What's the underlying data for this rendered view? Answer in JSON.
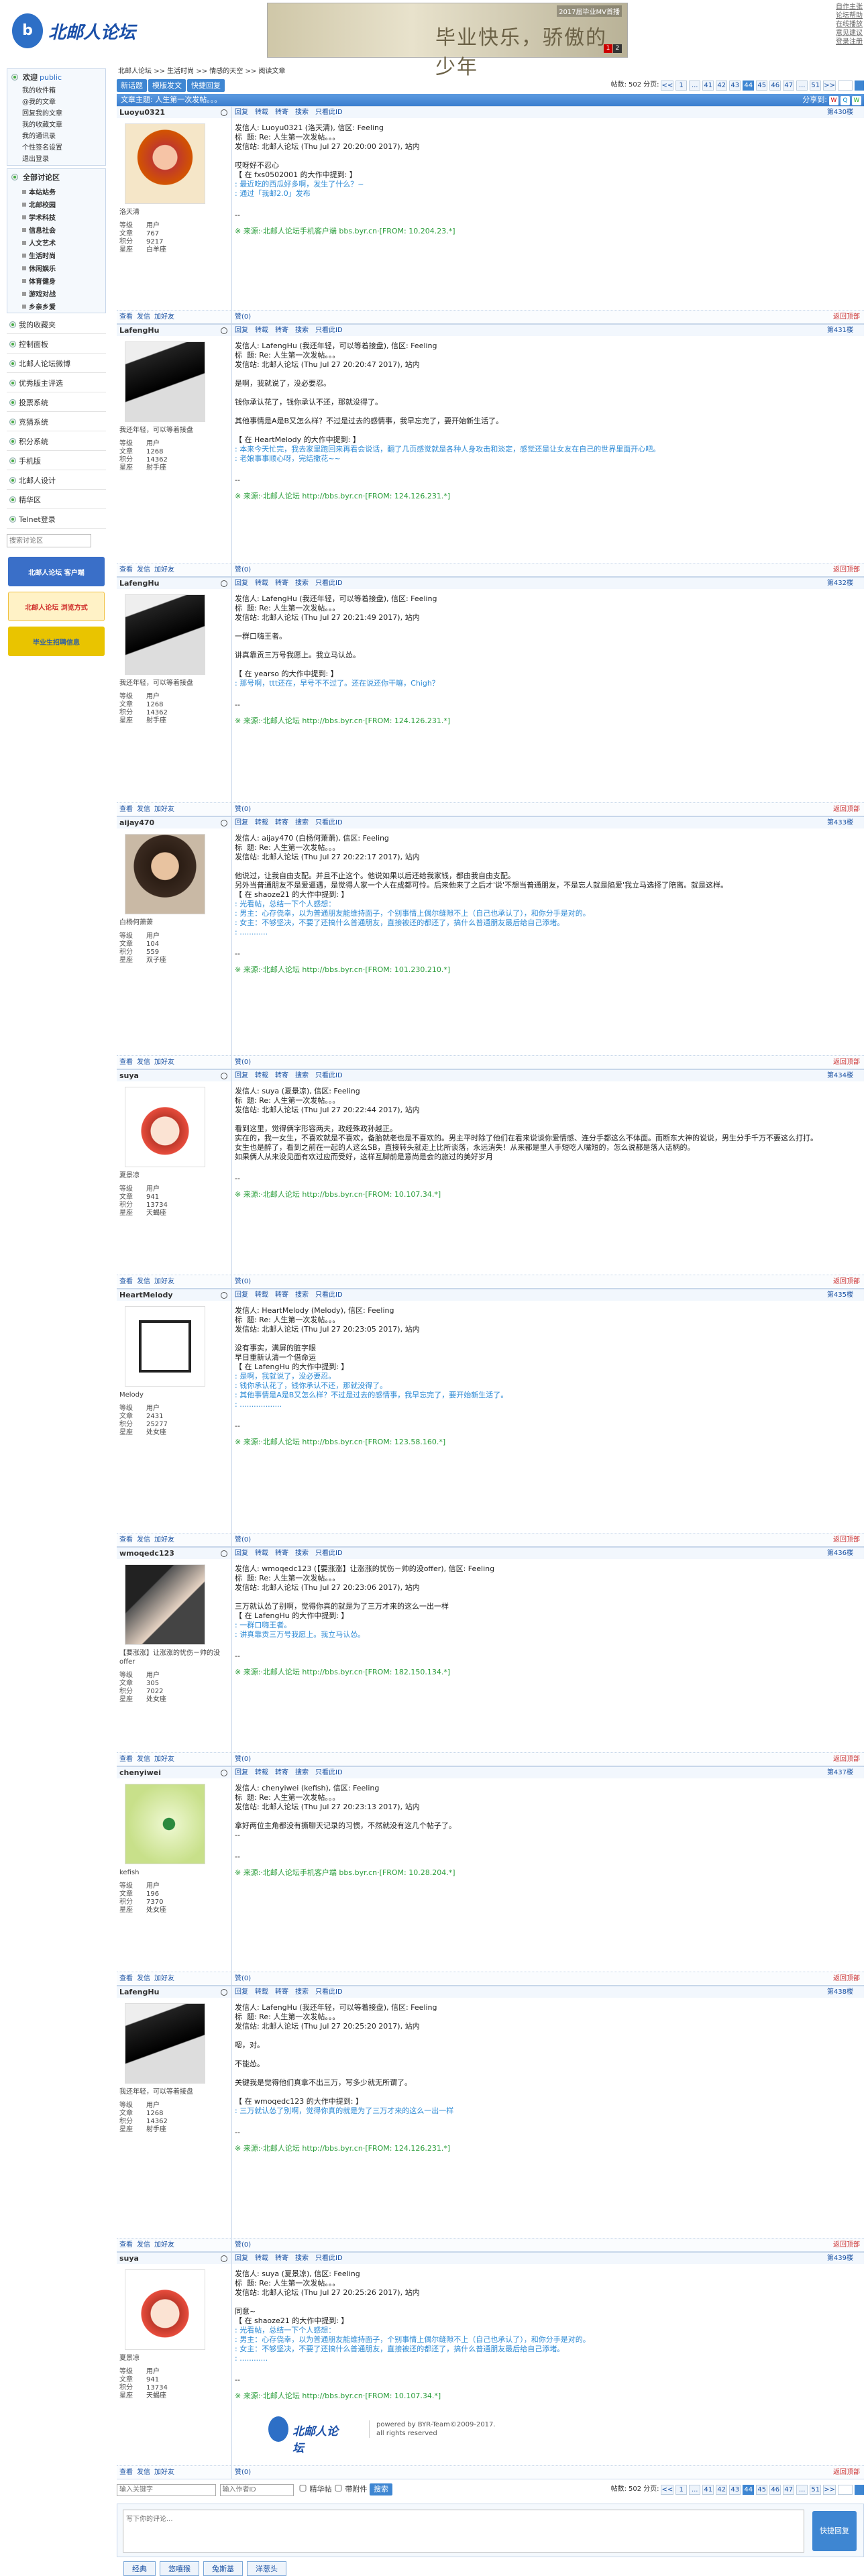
{
  "site": {
    "logo": "北邮人论坛",
    "top_links": [
      "自作主张",
      "论坛帮助",
      "在线播放",
      "意见建议",
      "登录注册"
    ],
    "banner_caption": "2017届毕业MV首播",
    "banner_text": "毕业快乐，骄傲的少年",
    "banner_pages": [
      "1",
      "2"
    ]
  },
  "sidebar": {
    "welcome": "欢迎",
    "user": "public",
    "user_links": [
      "我的收件箱",
      "@我的文章",
      "回复我的文章",
      "我的收藏文章",
      "我的通讯录",
      "个性签名设置",
      "退出登录"
    ],
    "board_title": "全部讨论区",
    "boards": [
      "本站站务",
      "北邮校园",
      "学术科技",
      "信息社会",
      "人文艺术",
      "生活时尚",
      "休闲娱乐",
      "体育健身",
      "游戏对战",
      "乡亲乡爱"
    ],
    "sections": [
      "我的收藏夹",
      "控制面板",
      "北邮人论坛微博",
      "优秀版主评选",
      "投票系统",
      "竞猜系统",
      "积分系统",
      "手机版",
      "北邮人设计",
      "精华区",
      "Telnet登录"
    ],
    "search_placeholder": "搜索讨论区",
    "ads": [
      "北邮人论坛 客户端",
      "北邮人论坛 浏览方式",
      "毕业生招聘信息"
    ]
  },
  "crumb": [
    "北邮人论坛",
    ">>",
    "生活时尚",
    ">>",
    "情感的天空",
    ">>",
    "阅读文章"
  ],
  "toolbar": {
    "new": "新话题",
    "template": "模版发文",
    "quick": "快捷回复"
  },
  "pager": {
    "count_label": "帖数:",
    "count": "502",
    "page_label": "分页:",
    "pages": [
      "<<",
      "1",
      "...",
      "41",
      "42",
      "43",
      "44",
      "45",
      "46",
      "47",
      "...",
      "51",
      ">>"
    ],
    "current": "44"
  },
  "thread_title": "文章主题: 人生第一次发帖。。。",
  "share_label": "分享到:",
  "labels": {
    "reply": "回复",
    "forward": "转载",
    "repost": "转寄",
    "search": "搜索",
    "only": "只看此ID",
    "level": "等级",
    "posts": "文章",
    "score": "积分",
    "sign": "星座",
    "view": "查看",
    "mail": "发信",
    "friend": "加好友",
    "zan": "赞(0)",
    "top": "返回顶部",
    "group": "用户"
  },
  "posts": [
    {
      "name": "Luoyu0321",
      "floor": "第430楼",
      "nick": "洛天清",
      "lv": "用户",
      "posts": "767",
      "score": "9217",
      "sign": "白羊座",
      "header": "发信人: Luoyu0321 (洛天清), 信区: Feeling\n标  题: Re: 人生第一次发帖。。。\n发信站: 北邮人论坛 (Thu Jul 27 20:20:00 2017), 站内",
      "body": "哎呀好不忍心\n【 在 fxs0502001 的大作中提到: 】",
      "quote": ": 最近吃的西瓜好多啊，发生了什么？~\n: 通过「我邮2.0」发布",
      "src": "※ 来源:·北邮人论坛手机客户端 bbs.byr.cn·[FROM: 10.204.23.*]"
    },
    {
      "name": "LafengHu",
      "floor": "第431楼",
      "nick": "我还年轻，可以等着接盘",
      "lv": "用户",
      "posts": "1268",
      "score": "14362",
      "sign": "射手座",
      "header": "发信人: LafengHu (我还年轻，可以等着接盘), 信区: Feeling\n标  题: Re: 人生第一次发帖。。。\n发信站: 北邮人论坛 (Thu Jul 27 20:20:47 2017), 站内",
      "body": "是啊，我就说了，没必要忍。\n\n钱你承认花了，钱你承认不还，那就没得了。\n\n其他事情是A是B又怎么样？不过是过去的感情事，我早忘完了，要开始新生活了。\n\n【 在 HeartMelody 的大作中提到: 】",
      "quote": ": 本来今天忙完，我去家里跑回来再看会说话，翻了几页感觉就是各种人身攻击和淡定，感觉还是让女友在自己的世界里面开心吧。\n: 老娘事事顺心呀，完结撒花~~",
      "src": "※ 来源:·北邮人论坛 http://bbs.byr.cn·[FROM: 124.126.231.*]"
    },
    {
      "name": "LafengHu",
      "floor": "第432楼",
      "nick": "我还年轻，可以等着接盘",
      "lv": "用户",
      "posts": "1268",
      "score": "14362",
      "sign": "射手座",
      "header": "发信人: LafengHu (我还年轻，可以等着接盘), 信区: Feeling\n标  题: Re: 人生第一次发帖。。。\n发信站: 北邮人论坛 (Thu Jul 27 20:21:49 2017), 站内",
      "body": "一群口嗨王者。\n\n讲真靠贡三万号我愿上。我立马认怂。\n\n【 在 yearso 的大作中提到: 】",
      "quote": ": 那号啊，ttt还在，早号不不过了。还在说还你干嘛，Chigh？",
      "src": "※ 来源:·北邮人论坛 http://bbs.byr.cn·[FROM: 124.126.231.*]"
    },
    {
      "name": "aijay470",
      "floor": "第433楼",
      "nick": "白杨何萧萧",
      "lv": "用户",
      "posts": "104",
      "score": "559",
      "sign": "双子座",
      "header": "发信人: aijay470 (白杨何萧萧), 信区: Feeling\n标  题: Re: 人生第一次发帖。。。\n发信站: 北邮人论坛 (Thu Jul 27 20:22:17 2017), 站内",
      "body": "他说过，让我自由支配。并且不止这个。他说如果以后还给我家钱，都由我自由支配。\n另外当普通朋友不是爱逼遇，是觉得人家一个人在成都可怜。后来他来了之后才'说'不想当普通朋友，不是忘人就是陷爱'我立马选择了陪离。就是这样。\n【 在 shaoze21 的大作中提到: 】",
      "quote": ": 光看帖，总结一下个人感想：\n: 男主：心存侥幸，以为普通朋友能维持面子，个别事情上偶尔缝隙不上（自己也承认了），和你分手是对的。\n: 女主：不够坚决，不要了还搞什么普通朋友，直接被还的都还了，搞什么普通朋友最后给自己添堵。\n: ............",
      "src": "※ 来源:·北邮人论坛 http://bbs.byr.cn·[FROM: 101.230.210.*]"
    },
    {
      "name": "suya",
      "floor": "第434楼",
      "nick": "夏景凉",
      "lv": "用户",
      "posts": "941",
      "score": "13734",
      "sign": "天蝎座",
      "header": "发信人: suya (夏景凉), 信区: Feeling\n标  题: Re: 人生第一次发帖。。。\n发信站: 北邮人论坛 (Thu Jul 27 20:22:44 2017), 站内",
      "body": "看到这里，觉得俩字形容两夫，政经殊政孙越正。\n实在的，我一女生，不喜欢就是不喜欢，备胎就老也是不喜欢的。男主平时除了他们在看来说谈你爱情感、连分手都这么不体面。而断东大神的说说，男生分手千万不要这么打打。\n女生也是醉了，看到之前在一起的人这么SB，直接转头就走上比所谈落，永远消失！从来都是里人手短吃人嘴短的，怎么说都是落人话柄的。\n如果俩人从来没见面有欢过应而受好，这样互脚前是意尚是会的旅过的美好岁月",
      "quote": "",
      "src": "※ 来源:·北邮人论坛 http://bbs.byr.cn·[FROM: 10.107.34.*]"
    },
    {
      "name": "HeartMelody",
      "floor": "第435楼",
      "nick": "Melody",
      "lv": "用户",
      "posts": "2431",
      "score": "25277",
      "sign": "处女座",
      "header": "发信人: HeartMelody (Melody), 信区: Feeling\n标  题: Re: 人生第一次发帖。。。\n发信站: 北邮人论坛 (Thu Jul 27 20:23:05 2017), 站内",
      "body": "没有事实，满屏的脏字眼\n早日重新认清一个借命运\n【 在 LafengHu 的大作中提到: 】",
      "quote": ": 是啊，我就说了，没必要忍。\n: 钱你承认花了，钱你承认不还，那就没得了。\n: 其他事情是A是B又怎么样？不过是过去的感情事，我早忘完了，要开始新生活了。\n: ..................",
      "src": "※ 来源:·北邮人论坛 http://bbs.byr.cn·[FROM: 123.58.160.*]"
    },
    {
      "name": "wmoqedc123",
      "floor": "第436楼",
      "nick": "【要涨涨】让涨涨的忧伤－帅的没offer",
      "lv": "用户",
      "posts": "305",
      "score": "7022",
      "sign": "处女座",
      "header": "发信人: wmoqedc123 (【要涨涨】让涨涨的忧伤－帅的没offer), 信区: Feeling\n标  题: Re: 人生第一次发帖。。。\n发信站: 北邮人论坛 (Thu Jul 27 20:23:06 2017), 站内",
      "body": "三万就认怂了别啊，觉得你真的就是为了三万才来的这么一出一样\n【 在 LafengHu 的大作中提到: 】",
      "quote": ": 一群口嗨王者。\n: 讲真靠贡三万号我愿上。我立马认怂。",
      "src": "※ 来源:·北邮人论坛 http://bbs.byr.cn·[FROM: 182.150.134.*]"
    },
    {
      "name": "chenyiwei",
      "floor": "第437楼",
      "nick": "kefish",
      "lv": "用户",
      "posts": "196",
      "score": "7370",
      "sign": "处女座",
      "header": "发信人: chenyiwei (kefish), 信区: Feeling\n标  题: Re: 人生第一次发帖。。。\n发信站: 北邮人论坛 (Thu Jul 27 20:23:13 2017), 站内",
      "body": "拿好两位主角都没有撕聊天记录的习惯，不然就没有这几个帖子了。\n--",
      "quote": "",
      "src": "※ 来源:·北邮人论坛手机客户端 bbs.byr.cn·[FROM: 10.28.204.*]"
    },
    {
      "name": "LafengHu",
      "floor": "第438楼",
      "nick": "我还年轻，可以等着接盘",
      "lv": "用户",
      "posts": "1268",
      "score": "14362",
      "sign": "射手座",
      "header": "发信人: LafengHu (我还年轻，可以等着接盘), 信区: Feeling\n标  题: Re: 人生第一次发帖。。。\n发信站: 北邮人论坛 (Thu Jul 27 20:25:20 2017), 站内",
      "body": "嗯，对。\n\n不能怂。\n\n关键我是觉得他们真拿不出三万，写多少就无所谓了。\n\n【 在 wmoqedc123 的大作中提到: 】",
      "quote": ": 三万就认怂了别啊，觉得你真的就是为了三万才来的这么一出一样",
      "src": "※ 来源:·北邮人论坛 http://bbs.byr.cn·[FROM: 124.126.231.*]"
    },
    {
      "name": "suya",
      "floor": "第439楼",
      "nick": "夏景凉",
      "lv": "用户",
      "posts": "941",
      "score": "13734",
      "sign": "天蝎座",
      "header": "发信人: suya (夏景凉), 信区: Feeling\n标  题: Re: 人生第一次发帖。。。\n发信站: 北邮人论坛 (Thu Jul 27 20:25:26 2017), 站内",
      "body": "同意~\n【 在 shaoze21 的大作中提到: 】",
      "quote": ": 光看帖，总结一下个人感想：\n: 男主：心存侥幸，以为普通朋友能维持面子，个别事情上偶尔缝隙不上（自己也承认了），和你分手是对的。\n: 女主：不够坚决，不要了还搞什么普通朋友，直接被还的都还了，搞什么普通朋友最后给自己添堵。\n: ............",
      "src": "※ 来源:·北邮人论坛 http://bbs.byr.cn·[FROM: 10.107.34.*]"
    }
  ],
  "bottom": {
    "kw_ph": "输入关键字",
    "id_ph": "输入作者ID",
    "elite": "精华帖",
    "attach": "带附件",
    "search": "搜索"
  },
  "reply": {
    "placeholder": "写下你的评论...",
    "send": "快捷回复"
  },
  "tabs": [
    "经典",
    "悠嘻猴",
    "兔斯基",
    "洋葱头"
  ],
  "footer": {
    "line1": "powered by BYR-Team©2009-2017.",
    "line2": "all rights reserved"
  }
}
